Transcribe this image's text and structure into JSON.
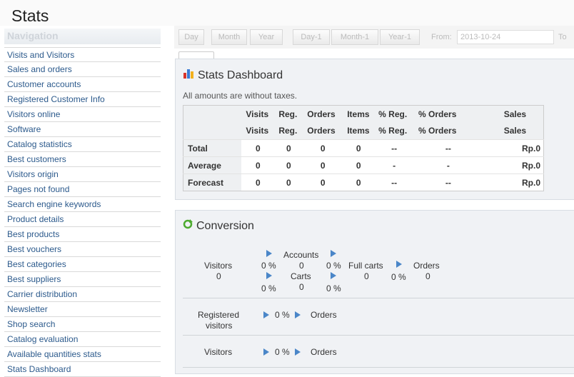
{
  "page": {
    "title": "Stats"
  },
  "sidebar": {
    "title": "Navigation",
    "items": [
      "Visits and Visitors",
      "Sales and orders",
      "Customer accounts",
      "Registered Customer Info",
      "Visitors online",
      "Software",
      "Catalog statistics",
      "Best customers",
      "Visitors origin",
      "Pages not found",
      "Search engine keywords",
      "Product details",
      "Best products",
      "Best vouchers",
      "Best categories",
      "Best suppliers",
      "Carrier distribution",
      "Newsletter",
      "Shop search",
      "Catalog evaluation",
      "Available quantities stats",
      "Stats Dashboard"
    ]
  },
  "toolbar": {
    "day": "Day",
    "month": "Month",
    "year": "Year",
    "day1": "Day-1",
    "month1": "Month-1",
    "year1": "Year-1",
    "from_label": "From:",
    "from_value": "2013-10-24",
    "to_label": "To"
  },
  "dashboard": {
    "title": "Stats Dashboard",
    "note": "All amounts are without taxes.",
    "columns": [
      "Visits",
      "Reg.",
      "Orders",
      "Items",
      "% Reg.",
      "% Orders",
      "Sales"
    ],
    "rows": [
      {
        "label": "Total",
        "values": [
          "0",
          "0",
          "0",
          "0",
          "--",
          "--",
          "Rp.0"
        ]
      },
      {
        "label": "Average",
        "values": [
          "0",
          "0",
          "0",
          "0",
          "-",
          "-",
          "Rp.0"
        ]
      },
      {
        "label": "Forecast",
        "values": [
          "0",
          "0",
          "0",
          "0",
          "--",
          "--",
          "Rp.0"
        ]
      }
    ]
  },
  "conversion": {
    "title": "Conversion",
    "funnel": {
      "visitors_label": "Visitors",
      "visitors_value": "0",
      "accounts_label": "Accounts",
      "accounts_value": "0",
      "carts_label": "Carts",
      "carts_value": "0",
      "fullcarts_label": "Full carts",
      "fullcarts_value": "0",
      "orders_label": "Orders",
      "orders_value": "0",
      "pct_top_left": "0 %",
      "pct_top_right": "0 %",
      "pct_bottom_left": "0 %",
      "pct_bottom_right": "0 %",
      "pct_fullcarts": "0 %"
    },
    "registered": {
      "label_line1": "Registered",
      "label_line2": "visitors",
      "pct": "0 %",
      "target": "Orders"
    },
    "visitors": {
      "label": "Visitors",
      "pct": "0 %",
      "target": "Orders"
    }
  },
  "colors": {
    "link": "#2c5a8c",
    "arrow": "#4a86c8",
    "panel_bg": "#f0f2f5"
  }
}
